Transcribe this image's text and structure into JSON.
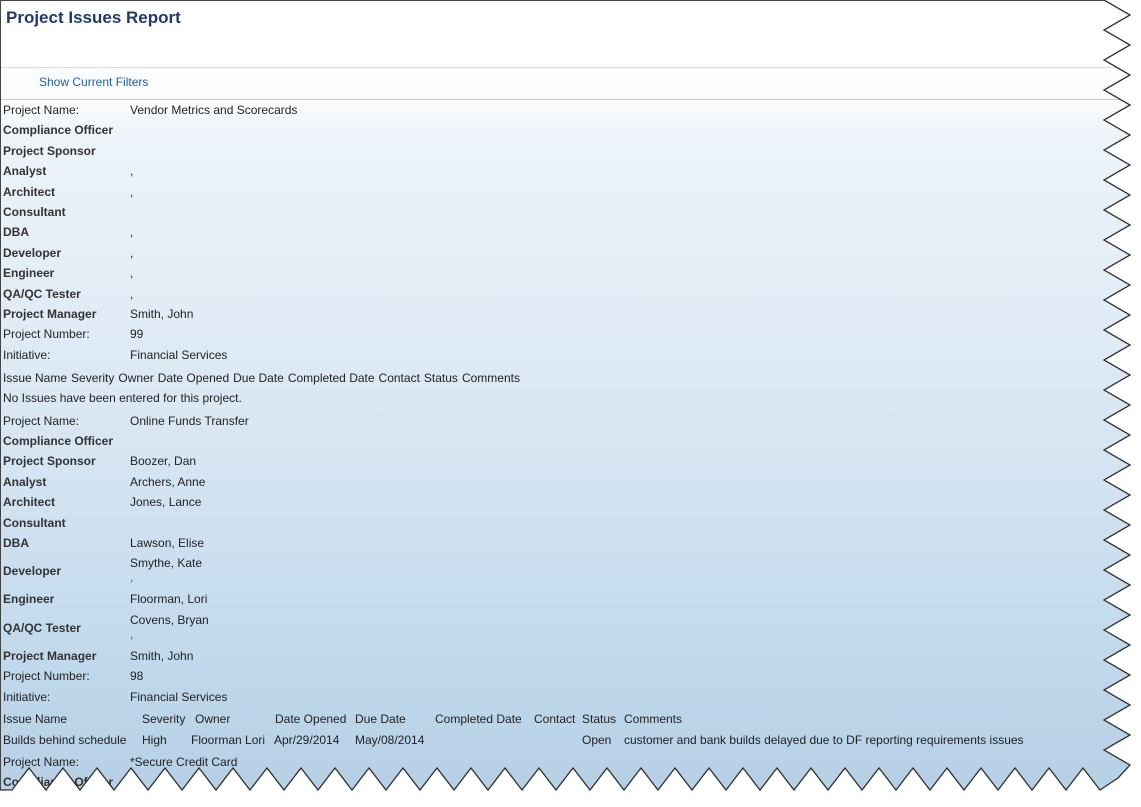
{
  "report": {
    "title": "Project Issues Report",
    "show_filters": "Show Current Filters"
  },
  "labels": {
    "project_name": "Project Name:",
    "compliance_officer": "Compliance Officer",
    "project_sponsor": "Project Sponsor",
    "analyst": "Analyst",
    "architect": "Architect",
    "consultant": "Consultant",
    "dba": "DBA",
    "developer": "Developer",
    "engineer": "Engineer",
    "qa_tester": "QA/QC Tester",
    "project_manager": "Project Manager",
    "project_number": "Project Number:",
    "initiative": "Initiative:"
  },
  "issue_headers": [
    "Issue Name",
    "Severity",
    "Owner",
    "Date Opened",
    "Due Date",
    "Completed Date",
    "Contact",
    "Status",
    "Comments"
  ],
  "projects": [
    {
      "name": "Vendor Metrics and Scorecards",
      "compliance_officer": "",
      "project_sponsor": "",
      "analyst": ",",
      "architect": ",",
      "consultant": "",
      "dba": ",",
      "developer": ",",
      "engineer": ",",
      "qa_tester": ",",
      "project_manager": "Smith, John",
      "project_number": "99",
      "initiative": "Financial Services",
      "no_issues": "No Issues have been entered for this project."
    },
    {
      "name": "Online Funds Transfer",
      "compliance_officer": "",
      "project_sponsor": "Boozer, Dan",
      "analyst": "Archers, Anne",
      "architect": "Jones, Lance",
      "consultant": "",
      "dba": "Lawson, Elise",
      "developer": "Smythe, Kate",
      "developer_sub": ",",
      "engineer": "Floorman, Lori",
      "qa_tester": "Covens, Bryan",
      "qa_tester_sub": ",",
      "project_manager": "Smith, John",
      "project_number": "98",
      "initiative": "Financial Services",
      "issues": [
        {
          "issue_name": "Builds behind schedule",
          "severity": "High",
          "owner": "Floorman Lori",
          "date_opened": "Apr/29/2014",
          "due_date": "May/08/2014",
          "completed_date": "",
          "contact": "",
          "status": "Open",
          "comments": "customer and bank builds delayed due to DF reporting requirements issues"
        }
      ]
    },
    {
      "name": "*Secure Credit Card"
    }
  ]
}
